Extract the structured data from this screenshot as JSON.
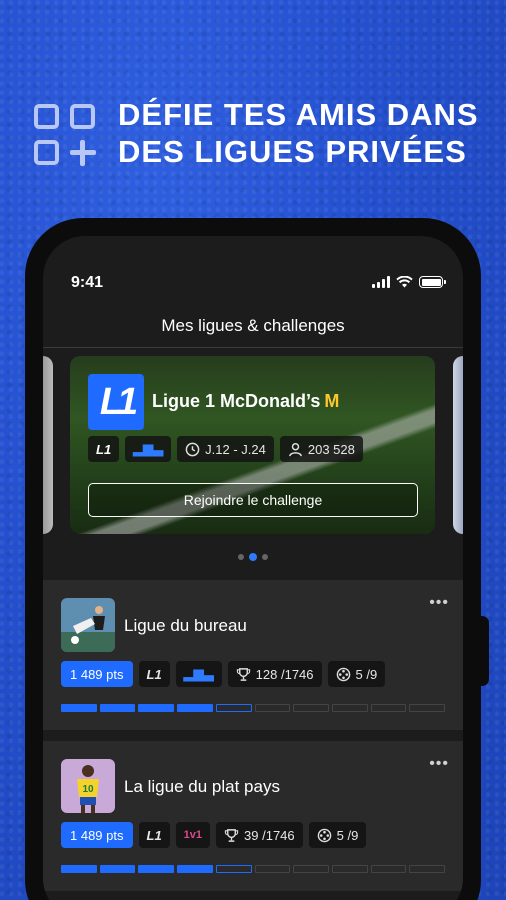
{
  "hero": {
    "title_line1": "Défie tes amis dans",
    "title_line2": "des ligues privées"
  },
  "status_bar": {
    "time": "9:41"
  },
  "screen": {
    "title": "Mes ligues & challenges"
  },
  "promo": {
    "logo_text": "L1",
    "name": "Ligue 1 McDonald’s",
    "brand_glyph": "M",
    "chips": {
      "l1": "L1",
      "podium": "▂▆▃",
      "rounds": "J.12 - J.24",
      "players": "203 528"
    },
    "join_label": "Rejoindre le challenge"
  },
  "carousel": {
    "pages": 3,
    "active": 1
  },
  "leagues": [
    {
      "name": "Ligue du bureau",
      "more": "•••",
      "points": "1 489 pts",
      "l1": "L1",
      "badge": "▂▆▃",
      "rank": "128 /1746",
      "reels": "5 /9",
      "progress_total": 10,
      "progress_done": 4
    },
    {
      "name": "La ligue du plat pays",
      "more": "•••",
      "points": "1 489 pts",
      "l1": "L1",
      "badge": "1v1",
      "rank": "39 /1746",
      "reels": "5 /9",
      "progress_total": 10,
      "progress_done": 4
    }
  ],
  "colors": {
    "background": "#2450cf",
    "accent": "#1f6bff",
    "mcd_yellow": "#ffc72c"
  },
  "icons": {
    "hero": "add-grid-icon",
    "clock": "clock-icon",
    "user": "user-icon",
    "trophy": "trophy-icon",
    "reel": "film-reel-icon"
  }
}
